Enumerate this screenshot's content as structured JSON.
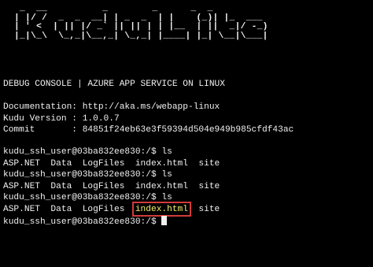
{
  "terminal": {
    "banner": "   _  __          _        _      _  _\n  | |/ /  _  _  __| | _  _  | |    (_)| |_  ___\n  | ' <  | || |/ _` || || | | |__  | ||  _|/ -_)\n  |_|\\_\\  \\_,_|\\__,_| \\_,_| |____| |_| \\__|\\___|",
    "header": "DEBUG CONSOLE | AZURE APP SERVICE ON LINUX",
    "documentation": "Documentation: http://aka.ms/webapp-linux",
    "kudu_version": "Kudu Version : 1.0.0.7",
    "commit": "Commit       : 84851f24eb63e3f59394d504e949b985cfdf43ac",
    "prompt_1": "kudu_ssh_user@03ba832ee830:/$ ls",
    "output_1": "ASP.NET  Data  LogFiles  index.html  site",
    "prompt_2": "kudu_ssh_user@03ba832ee830:/$ ls",
    "output_2": "ASP.NET  Data  LogFiles  index.html  site",
    "prompt_3": "kudu_ssh_user@03ba832ee830:/$ ls",
    "output_3_pre": "ASP.NET  Data  LogFiles  ",
    "output_3_highlight": "index.html",
    "output_3_post": "  site",
    "prompt_current": "kudu_ssh_user@03ba832ee830:/$ ",
    "highlight_color": "#f3ef6a",
    "highlight_border_color": "#d23a3a"
  }
}
